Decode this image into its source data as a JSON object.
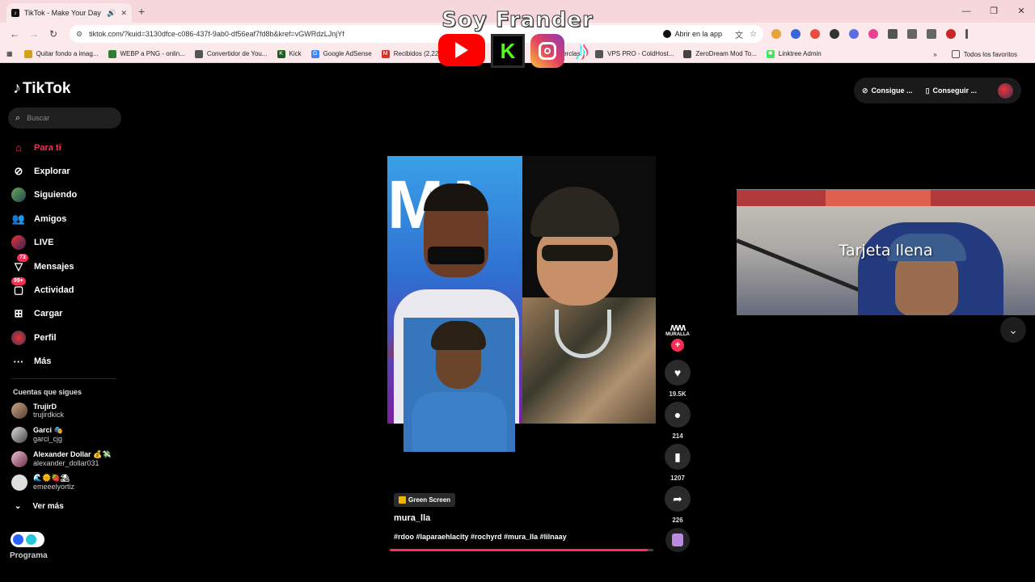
{
  "browser": {
    "tab_title": "TikTok - Make Your Day",
    "url": "tiktok.com/?kuid=3130dfce-c086-437f-9ab0-df56eaf7fd8b&kref=vGWRdzLJnjYf",
    "open_app": "Abrir en la app",
    "bookmarks": [
      {
        "label": "Quitar fondo a imag...",
        "color": "#d4a017"
      },
      {
        "label": "WEBP a PNG - onlin...",
        "color": "#2e7d32"
      },
      {
        "label": "Convertidor de You...",
        "color": "#555555"
      },
      {
        "label": "Kick",
        "color": "#1b5e20"
      },
      {
        "label": "Google AdSense",
        "color": "#4285f4"
      },
      {
        "label": "Recibidos (2,229",
        "color": "#d93025"
      },
      {
        "label": "Masterclas...",
        "color": "#444444"
      },
      {
        "label": "VPS PRO - ColdHost...",
        "color": "#555555"
      },
      {
        "label": "ZeroDream Mod To...",
        "color": "#444444"
      },
      {
        "label": "Linktree Admin",
        "color": "#43e55e"
      }
    ],
    "all_bookmarks": "Todos los favoritos"
  },
  "overlay": {
    "title": "Soy Frander"
  },
  "tiktok": {
    "logo": "TikTok",
    "search_placeholder": "Buscar",
    "nav": [
      {
        "label": "Para ti",
        "icon": "home-icon"
      },
      {
        "label": "Explorar",
        "icon": "compass-icon"
      },
      {
        "label": "Siguiendo",
        "icon": "following-avatar"
      },
      {
        "label": "Amigos",
        "icon": "friends-icon"
      },
      {
        "label": "LIVE",
        "icon": "live-icon"
      },
      {
        "label": "Mensajes",
        "icon": "messages-icon",
        "badge": "73"
      },
      {
        "label": "Actividad",
        "icon": "activity-icon",
        "badge": "99+"
      },
      {
        "label": "Cargar",
        "icon": "upload-icon"
      },
      {
        "label": "Perfil",
        "icon": "profile-icon"
      },
      {
        "label": "Más",
        "icon": "more-icon"
      }
    ],
    "following_title": "Cuentas que sigues",
    "accounts": [
      {
        "name": "TrujirD",
        "handle": "trujirdkick"
      },
      {
        "name": "Garci 🎭",
        "handle": "garci_cjg"
      },
      {
        "name": "Alexander Dollar 💰💸",
        "handle": "alexander_dollar031"
      },
      {
        "name": "🌊🌞🍓⛱",
        "handle": "emeeelyortiz"
      }
    ],
    "see_more": "Ver más",
    "program": "Programa",
    "top_buttons": [
      "Consigue ...",
      "Conseguir ..."
    ],
    "video": {
      "tag": "Green Screen",
      "author": "mura_lla",
      "caption": "#rdoo #laparaehlacity #rochyrd #mura_lla #lilnaay",
      "progress": 0.98,
      "creator_label": "MURALLA"
    },
    "actions": [
      {
        "name": "like",
        "count": "19.5K"
      },
      {
        "name": "comment",
        "count": "214"
      },
      {
        "name": "save",
        "count": "1207"
      },
      {
        "name": "share",
        "count": "226"
      }
    ],
    "webcam_label": "Tarjeta llena"
  }
}
